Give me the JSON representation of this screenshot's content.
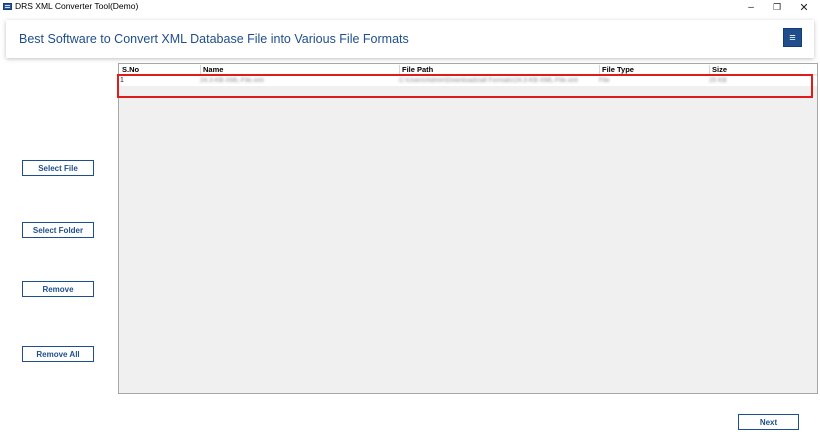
{
  "window": {
    "title": "DRS XML Converter Tool(Demo)",
    "minimize_glyph": "–",
    "maximize_glyph": "❐",
    "close_glyph": "✕"
  },
  "header": {
    "title": "Best Software to Convert XML Database File into Various File Formats",
    "menu_icon": "hamburger-menu-icon",
    "menu_glyph": "≡"
  },
  "sidebar": {
    "select_file": "Select File",
    "select_folder": "Select Folder",
    "remove": "Remove",
    "remove_all": "Remove All"
  },
  "table": {
    "columns": [
      "S.No",
      "Name",
      "File Path",
      "File Type",
      "Size"
    ],
    "rows": [
      {
        "sno": "1",
        "name": "24.3-KB-XML-File.xml",
        "path": "C:\\Users\\Admin\\Downloads\\all Formats\\24.3-KB-XML-File.xml",
        "type": "File",
        "size": "25 KB"
      }
    ]
  },
  "footer": {
    "next": "Next"
  },
  "colors": {
    "brand": "#1f4e8c",
    "highlight": "#e01b1b",
    "panel": "#f0f0f0"
  }
}
